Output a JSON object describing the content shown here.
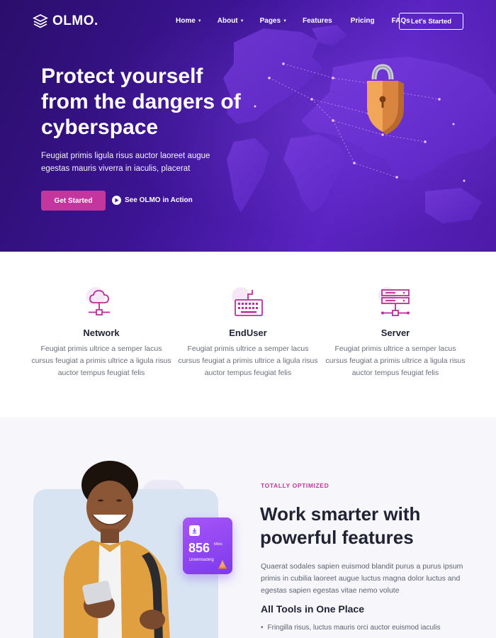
{
  "nav": {
    "logo_text": "OLMO.",
    "items": [
      {
        "label": "Home",
        "has_caret": true
      },
      {
        "label": "About",
        "has_caret": true
      },
      {
        "label": "Pages",
        "has_caret": true
      },
      {
        "label": "Features",
        "has_caret": false
      },
      {
        "label": "Pricing",
        "has_caret": false
      },
      {
        "label": "FAQs",
        "has_caret": false
      }
    ],
    "cta_label": "Let's Started"
  },
  "hero": {
    "title": "Protect yourself from the dangers of cyberspace",
    "subtitle": "Feugiat primis ligula risus auctor laoreet augue egestas mauris viverra in iaculis, placerat",
    "primary_button": "Get Started",
    "secondary_link": "See OLMO in Action",
    "illustration_icon": "padlock-shield-icon"
  },
  "features": [
    {
      "icon": "cloud-network-icon",
      "title": "Network",
      "text": "Feugiat primis ultrice a semper lacus cursus feugiat a primis ultrice a ligula risus auctor tempus feugiat felis"
    },
    {
      "icon": "keyboard-icon",
      "title": "EndUser",
      "text": "Feugiat primis ultrice a semper lacus cursus feugiat a primis ultrice a ligula risus auctor tempus feugiat felis"
    },
    {
      "icon": "server-icon",
      "title": "Server",
      "text": "Feugiat primis ultrice a semper lacus cursus feugiat a primis ultrice a ligula risus auctor tempus feugiat felis"
    }
  ],
  "section": {
    "eyebrow": "TOTALLY OPTIMIZED",
    "title": "Work smarter with powerful features",
    "text": "Quaerat sodales sapien euismod blandit purus a purus ipsum primis in cubilia laoreet augue luctus magna dolor luctus and egestas sapien egestas vitae nemo volute",
    "subtitle": "All Tools in One Place",
    "bullets": [
      "Fringilla risus, luctus mauris orci auctor euismod iaculis"
    ],
    "stat": {
      "value": "856",
      "unit": "Mb/s",
      "label": "Downloading"
    }
  },
  "colors": {
    "accent": "#c2369e",
    "hero_purple": "#3c1494",
    "stat_card": "#8b5cf6"
  }
}
